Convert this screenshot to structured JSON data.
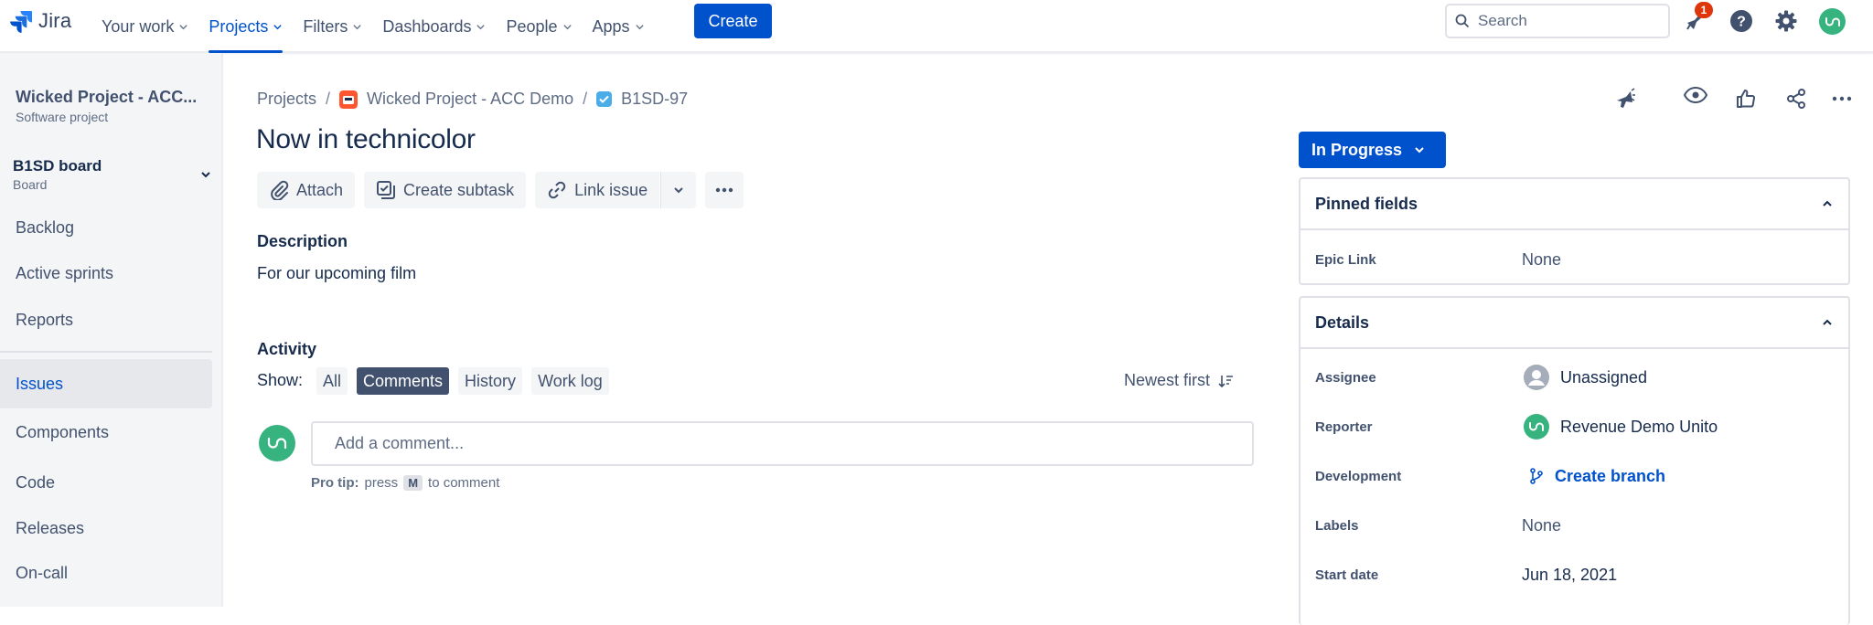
{
  "colors": {
    "brand": "#0052cc",
    "nav_text": "#42526e",
    "badge": "#de350b",
    "avatar": "#36b37e"
  },
  "topnav": {
    "logo_text": "Jira",
    "items": [
      {
        "label": "Your work",
        "active": false
      },
      {
        "label": "Projects",
        "active": true
      },
      {
        "label": "Filters",
        "active": false
      },
      {
        "label": "Dashboards",
        "active": false
      },
      {
        "label": "People",
        "active": false
      },
      {
        "label": "Apps",
        "active": false
      }
    ],
    "create_label": "Create",
    "search_placeholder": "Search",
    "notification_count": "1",
    "icons": [
      "notifications-icon",
      "help-icon",
      "settings-icon",
      "profile-avatar"
    ]
  },
  "sidebar": {
    "project_name": "Wicked Project - ACC...",
    "project_type": "Software project",
    "board_name": "B1SD board",
    "board_sub": "Board",
    "items": [
      {
        "label": "Backlog"
      },
      {
        "label": "Active sprints"
      },
      {
        "label": "Reports"
      },
      {
        "label": "Issues",
        "active": true
      },
      {
        "label": "Components"
      },
      {
        "label": "Code"
      },
      {
        "label": "Releases"
      },
      {
        "label": "On-call"
      }
    ]
  },
  "breadcrumb": {
    "projects": "Projects",
    "project": "Wicked Project - ACC Demo",
    "issue_key": "B1SD-97"
  },
  "issue": {
    "title": "Now in technicolor",
    "toolbar": {
      "attach": "Attach",
      "create_subtask": "Create subtask",
      "link_issue": "Link issue"
    },
    "description_heading": "Description",
    "description": "For our upcoming film"
  },
  "activity": {
    "heading": "Activity",
    "show_label": "Show:",
    "filters": [
      {
        "label": "All",
        "selected": false
      },
      {
        "label": "Comments",
        "selected": true
      },
      {
        "label": "History",
        "selected": false
      },
      {
        "label": "Work log",
        "selected": false
      }
    ],
    "sort_label": "Newest first",
    "comment_placeholder": "Add a comment...",
    "protip_label": "Pro tip:",
    "protip_press": "press",
    "protip_key": "M",
    "protip_suffix": "to comment"
  },
  "status": {
    "label": "In Progress"
  },
  "pinned": {
    "heading": "Pinned fields",
    "epic_link_label": "Epic Link",
    "epic_link_value": "None"
  },
  "details": {
    "heading": "Details",
    "assignee_label": "Assignee",
    "assignee_value": "Unassigned",
    "reporter_label": "Reporter",
    "reporter_value": "Revenue Demo Unito",
    "development_label": "Development",
    "development_value": "Create branch",
    "labels_label": "Labels",
    "labels_value": "None",
    "start_date_label": "Start date",
    "start_date_value": "Jun 18, 2021"
  }
}
